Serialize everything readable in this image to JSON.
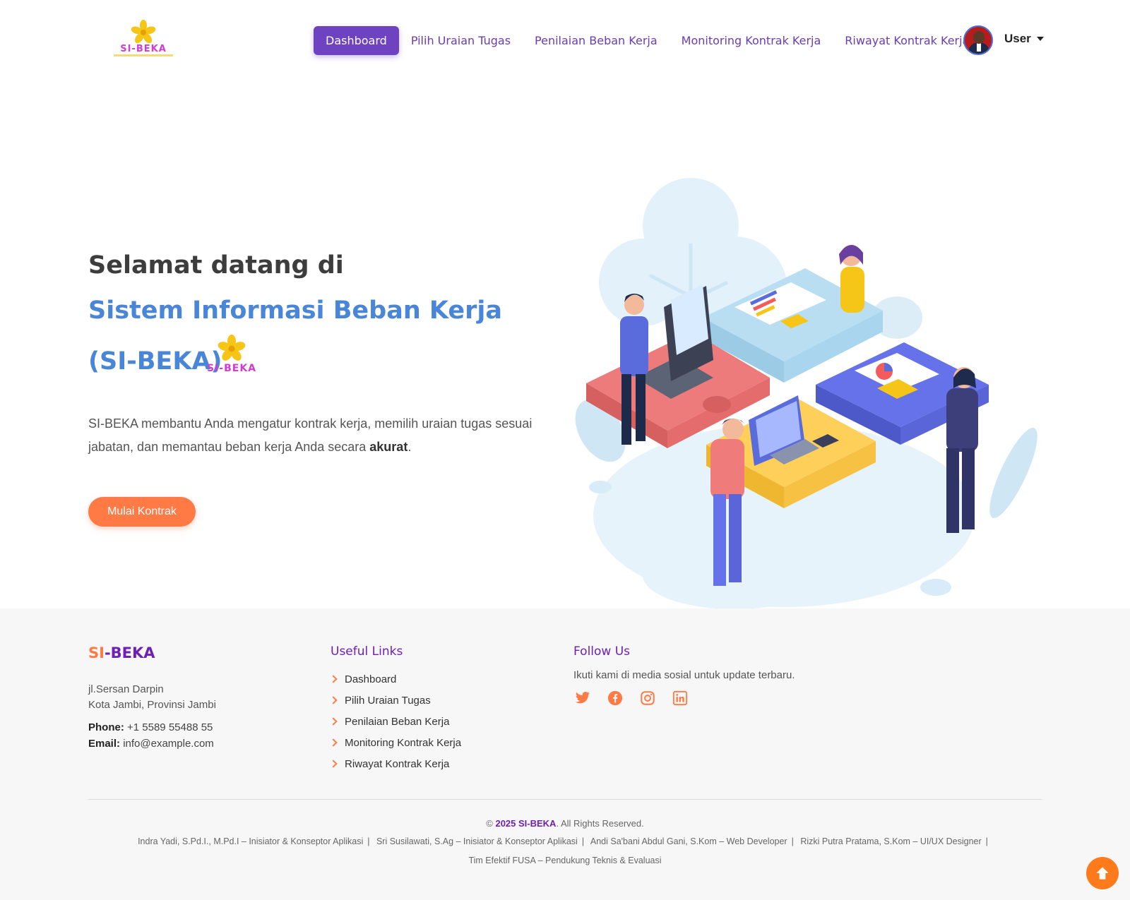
{
  "brand": {
    "logo_text": "SI-BEKA",
    "color_accent": "#6f42c1",
    "color_orange": "#ff7a45"
  },
  "nav": {
    "items": [
      {
        "label": "Dashboard",
        "active": true
      },
      {
        "label": "Pilih Uraian Tugas",
        "active": false
      },
      {
        "label": "Penilaian Beban Kerja",
        "active": false
      },
      {
        "label": "Monitoring Kontrak Kerja",
        "active": false
      },
      {
        "label": "Riwayat Kontrak Kerja",
        "active": false
      }
    ],
    "user_label": "User"
  },
  "hero": {
    "title_line1": "Selamat datang di",
    "title_line2": "Sistem Informasi Beban Kerja (SI-BEKA)",
    "description_before": "SI-BEKA membantu Anda mengatur kontrak kerja, memilih uraian tugas sesuai jabatan, dan memantau beban kerja Anda secara ",
    "description_bold": "akurat",
    "description_after": ".",
    "cta_label": "Mulai Kontrak"
  },
  "footer": {
    "brand_part1": "SI",
    "brand_part2": "-BEKA",
    "address_line1": "jl.Sersan Darpin",
    "address_line2": "Kota Jambi, Provinsi Jambi",
    "phone_label": "Phone:",
    "phone": "+1 5589 55488 55",
    "email_label": "Email:",
    "email": "info@example.com",
    "useful_links_title": "Useful Links",
    "useful_links": [
      "Dashboard",
      "Pilih Uraian Tugas",
      "Penilaian Beban Kerja",
      "Monitoring Kontrak Kerja",
      "Riwayat Kontrak Kerja"
    ],
    "follow_title": "Follow Us",
    "follow_text": "Ikuti kami di media sosial untuk update terbaru.",
    "socials": [
      "twitter-icon",
      "facebook-icon",
      "instagram-icon",
      "linkedin-icon"
    ],
    "copyright_prefix": "©",
    "copyright_bold": "2025 SI-BEKA",
    "copyright_suffix": ". All Rights Reserved.",
    "credits": [
      "Indra Yadi, S.Pd.I., M.Pd.I – Inisiator & Konseptor Aplikasi",
      "Sri Susilawati, S.Ag – Inisiator & Konseptor Aplikasi",
      "Andi Sa'bani Abdul Gani, S.Kom – Web Developer",
      "Rizki Putra Pratama, S.Kom – UI/UX Designer",
      "Tim Efektif FUSA – Pendukung Teknis & Evaluasi"
    ]
  }
}
